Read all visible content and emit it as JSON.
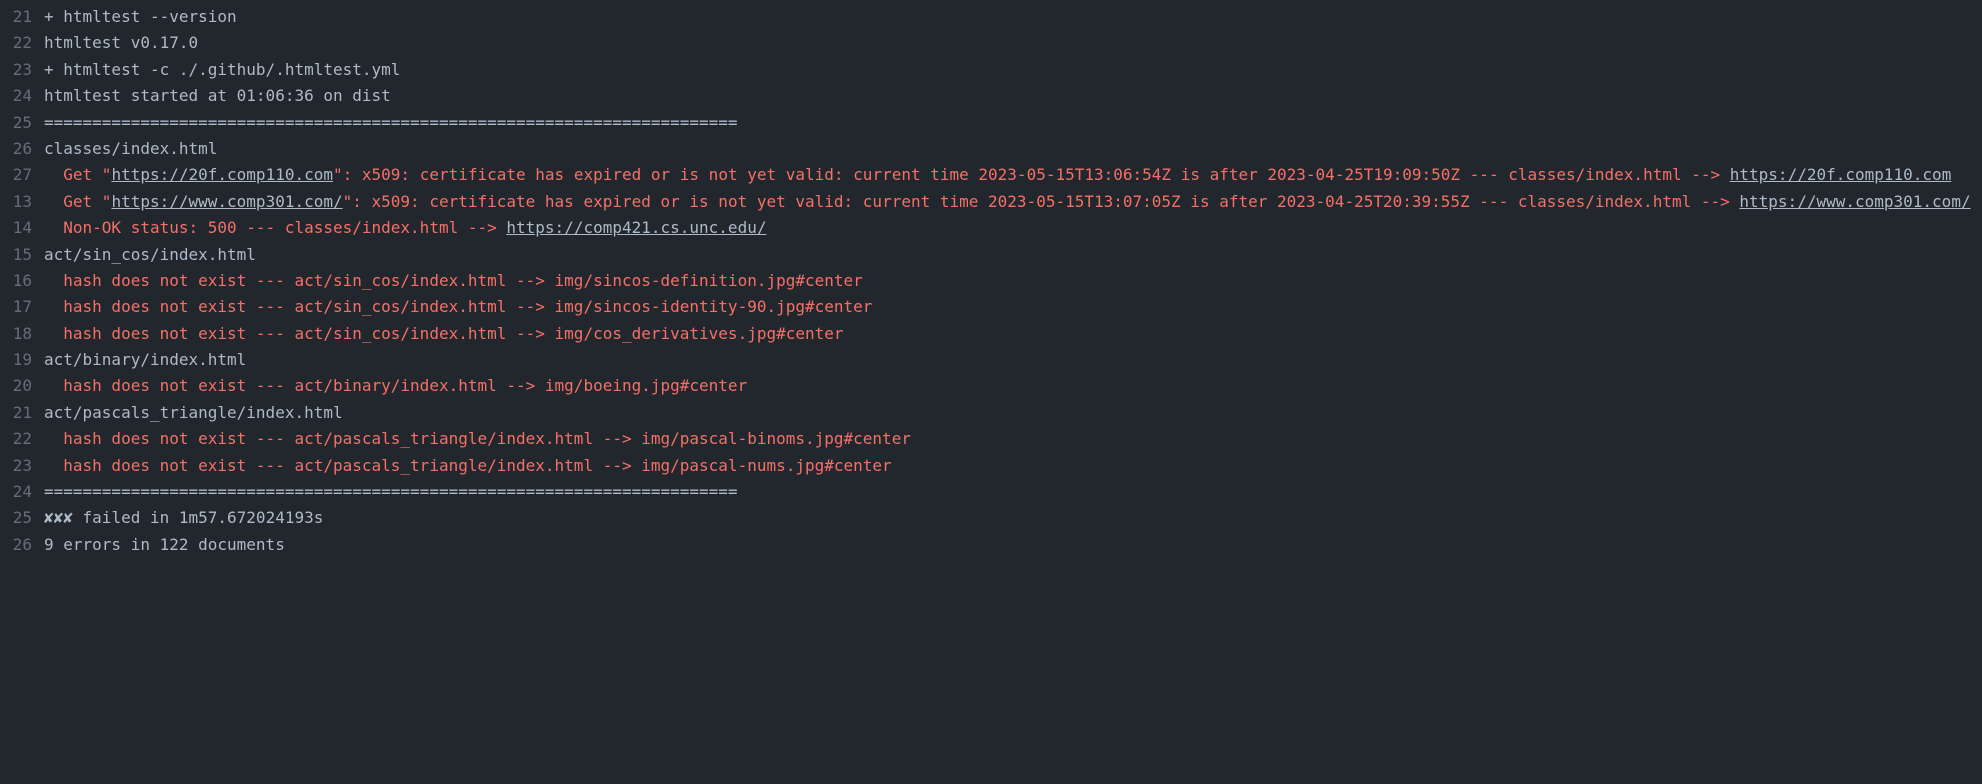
{
  "lines": [
    {
      "n": "21",
      "plain": "+ htmltest --version"
    },
    {
      "n": "22",
      "plain": "htmltest v0.17.0"
    },
    {
      "n": "23",
      "plain": "+ htmltest -c ./.github/.htmltest.yml"
    },
    {
      "n": "24",
      "plain": "htmltest started at 01:06:36 on dist"
    },
    {
      "n": "25",
      "plain": "========================================================================"
    },
    {
      "n": "26",
      "plain": "classes/index.html"
    },
    {
      "n": "27",
      "segments": [
        {
          "text": "  Get \"",
          "cls": "err"
        },
        {
          "text": "https://20f.comp110.com",
          "cls": "err",
          "link": true
        },
        {
          "text": "\": x509: certificate has expired or is not yet valid: current time 2023-05-15T13:06:54Z is after 2023-04-25T19:09:50Z --- classes/index.html --> ",
          "cls": "err"
        },
        {
          "text": "https://20f.comp110.com",
          "cls": "err",
          "link": true
        }
      ]
    },
    {
      "n": "13",
      "segments": [
        {
          "text": "  Get \"",
          "cls": "err"
        },
        {
          "text": "https://www.comp301.com/",
          "cls": "err",
          "link": true
        },
        {
          "text": "\": x509: certificate has expired or is not yet valid: current time 2023-05-15T13:07:05Z is after 2023-04-25T20:39:55Z --- classes/index.html --> ",
          "cls": "err"
        },
        {
          "text": "https://www.comp301.com/",
          "cls": "err",
          "link": true
        }
      ]
    },
    {
      "n": "14",
      "segments": [
        {
          "text": "  Non-OK status: 500 --- classes/index.html --> ",
          "cls": "err"
        },
        {
          "text": "https://comp421.cs.unc.edu/",
          "cls": "err",
          "link": true
        }
      ]
    },
    {
      "n": "15",
      "plain": "act/sin_cos/index.html"
    },
    {
      "n": "16",
      "segments": [
        {
          "text": "  hash does not exist --- act/sin_cos/index.html --> img/sincos-definition.jpg#center",
          "cls": "err"
        }
      ]
    },
    {
      "n": "17",
      "segments": [
        {
          "text": "  hash does not exist --- act/sin_cos/index.html --> img/sincos-identity-90.jpg#center",
          "cls": "err"
        }
      ]
    },
    {
      "n": "18",
      "segments": [
        {
          "text": "  hash does not exist --- act/sin_cos/index.html --> img/cos_derivatives.jpg#center",
          "cls": "err"
        }
      ]
    },
    {
      "n": "19",
      "plain": "act/binary/index.html"
    },
    {
      "n": "20",
      "segments": [
        {
          "text": "  hash does not exist --- act/binary/index.html --> img/boeing.jpg#center",
          "cls": "err"
        }
      ]
    },
    {
      "n": "21",
      "plain": "act/pascals_triangle/index.html"
    },
    {
      "n": "22",
      "segments": [
        {
          "text": "  hash does not exist --- act/pascals_triangle/index.html --> img/pascal-binoms.jpg#center",
          "cls": "err"
        }
      ]
    },
    {
      "n": "23",
      "segments": [
        {
          "text": "  hash does not exist --- act/pascals_triangle/index.html --> img/pascal-nums.jpg#center",
          "cls": "err"
        }
      ]
    },
    {
      "n": "24",
      "plain": "========================================================================"
    },
    {
      "n": "25",
      "segments": [
        {
          "text": "✘✘✘",
          "cls": "white"
        },
        {
          "text": " failed in 1m57.672024193s",
          "cls": "white"
        }
      ]
    },
    {
      "n": "26",
      "plain": "9 errors in 122 documents"
    }
  ]
}
